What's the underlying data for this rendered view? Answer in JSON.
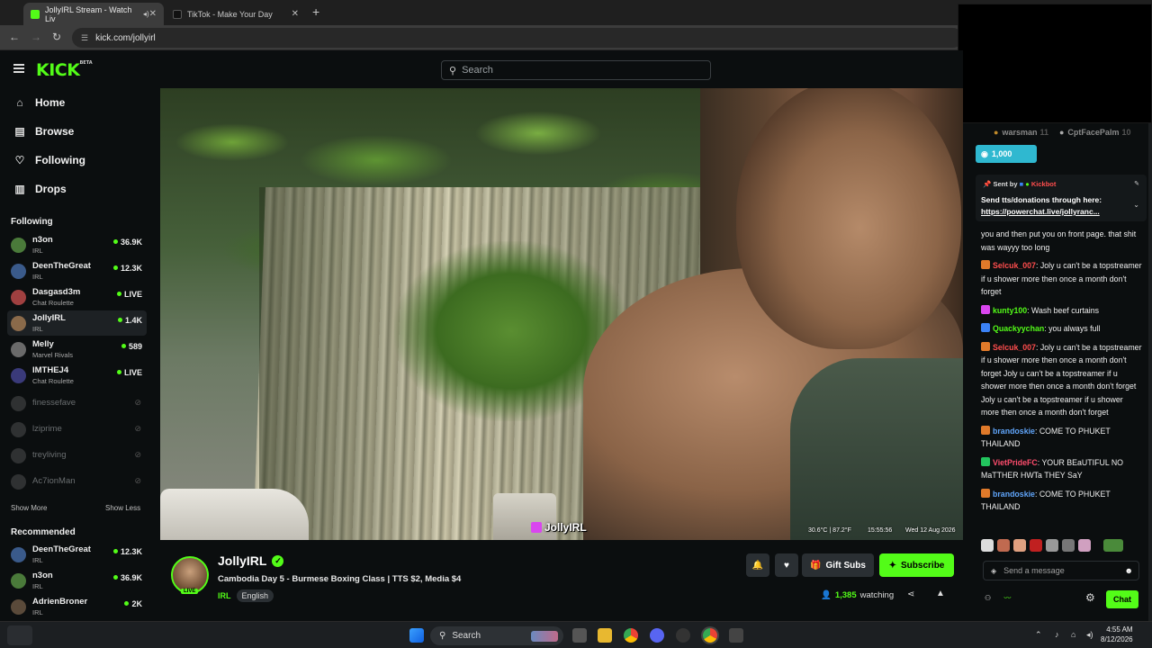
{
  "browser": {
    "tabs": [
      {
        "title": "JollyIRL Stream - Watch Liv",
        "active": true
      },
      {
        "title": "TikTok - Make Your Day",
        "active": false
      }
    ],
    "url": "kick.com/jollyirl"
  },
  "header": {
    "logo": "KICK",
    "logo_tag": "BETA",
    "search_placeholder": "Search"
  },
  "nav": {
    "home": "Home",
    "browse": "Browse",
    "following": "Following",
    "drops": "Drops"
  },
  "sidebar": {
    "following_title": "Following",
    "following": [
      {
        "name": "n3on",
        "category": "IRL",
        "viewers": "36.9K",
        "color": "#4a7a3a"
      },
      {
        "name": "DeenTheGreat",
        "category": "IRL",
        "viewers": "12.3K",
        "color": "#3a5a8a"
      },
      {
        "name": "Dasgasd3m",
        "category": "Chat Roulette",
        "viewers": "LIVE",
        "color": "#a04040"
      },
      {
        "name": "JollyIRL",
        "category": "IRL",
        "viewers": "1.4K",
        "color": "#8a6a4a"
      },
      {
        "name": "Melly",
        "category": "Marvel Rivals",
        "viewers": "589",
        "color": "#6a6a6a"
      },
      {
        "name": "IMTHEJ4",
        "category": "Chat Roulette",
        "viewers": "LIVE",
        "color": "#3a3a7a"
      }
    ],
    "offline": [
      {
        "name": "finessefave",
        "color": "#666"
      },
      {
        "name": "lziprime",
        "color": "#666"
      },
      {
        "name": "treyliving",
        "color": "#666"
      },
      {
        "name": "Ac7ionMan",
        "color": "#666"
      }
    ],
    "show_more": "Show More",
    "show_less": "Show Less",
    "recommended_title": "Recommended",
    "recommended": [
      {
        "name": "DeenTheGreat",
        "category": "IRL",
        "viewers": "12.3K",
        "color": "#3a5a8a"
      },
      {
        "name": "n3on",
        "category": "IRL",
        "viewers": "36.9K",
        "color": "#4a7a3a"
      },
      {
        "name": "AdrienBroner",
        "category": "IRL",
        "viewers": "2K",
        "color": "#5a4a3a"
      }
    ]
  },
  "video": {
    "temp": "30.6°C | 87.2°F",
    "time": "15:55:56",
    "date": "Wed 12 Aug 2026",
    "watermark": "JollyIRL"
  },
  "stream": {
    "streamer": "JollyIRL",
    "live_badge": "LIVE",
    "title": "Cambodia Day 5 - Burmese Boxing Class | TTS $2, Media $4",
    "category": "IRL",
    "tag": "English",
    "gift_label": "Gift Subs",
    "subscribe_label": "Subscribe",
    "watching_count": "1,385",
    "watching_label": "watching"
  },
  "chat": {
    "top_users": [
      {
        "name": "warsman",
        "count": "11"
      },
      {
        "name": "CptFacePalm",
        "count": "10"
      }
    ],
    "kicks_amount": "1,000",
    "pinned": {
      "sent_by_label": "Sent by",
      "sender": "Kickbot",
      "text": "Send tts/donations through here:",
      "link": "https://powerchat.live/jollyranc..."
    },
    "messages": [
      {
        "user": "",
        "color": "#efefef",
        "badge": "",
        "text": "you and then put you on front page. that shit was wayyy too long"
      },
      {
        "user": "Selcuk_007",
        "color": "#ff4d4d",
        "badge": "#e07a2a",
        "text": "Joly u can't be a topstreamer if u shower more then once a month don't forget"
      },
      {
        "user": "kunty100",
        "color": "#53fc18",
        "badge": "#d946ef",
        "text": "Wash beef curtains"
      },
      {
        "user": "Quackyychan",
        "color": "#53fc18",
        "badge": "#3b82f6",
        "text": "you always full"
      },
      {
        "user": "Selcuk_007",
        "color": "#ff4d4d",
        "badge": "#e07a2a",
        "text": "Joly u can't be a topstreamer if u shower more then once a month don't forget Joly u can't be a topstreamer if u shower more then once a month don't forget Joly u can't be a topstreamer if u shower more then once a month don't forget"
      },
      {
        "user": "brandoskie",
        "color": "#60a5fa",
        "badge": "#e07a2a",
        "text": "COME TO PHUKET THAILAND"
      },
      {
        "user": "VietPrideFC",
        "color": "#ff4d6d",
        "badge": "#22c55e",
        "text": "YOUR BEaUTIFUL NO MaTTHER HWTa THEY SaY"
      },
      {
        "user": "brandoskie",
        "color": "#60a5fa",
        "badge": "#e07a2a",
        "text": "COME TO PHUKET THAILAND"
      }
    ],
    "input_placeholder": "Send a message",
    "send_label": "Chat"
  },
  "taskbar": {
    "search": "Search",
    "time": "4:55 AM",
    "date": "8/12/2026"
  }
}
